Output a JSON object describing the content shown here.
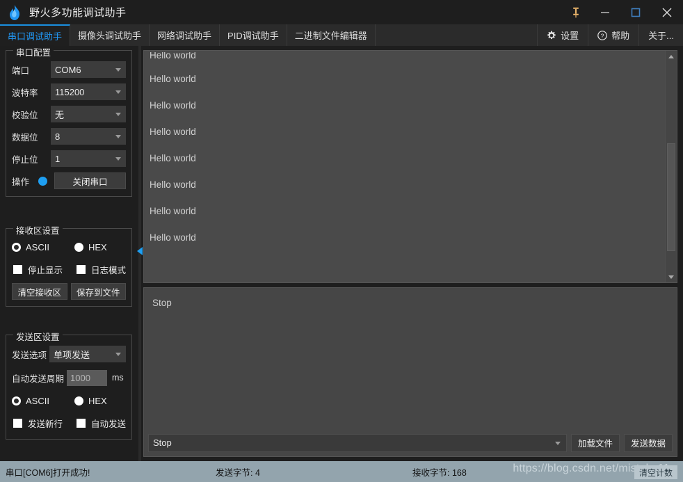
{
  "window": {
    "title": "野火多功能调试助手",
    "logo_icon": "flame-logo-icon",
    "pin_icon": "pin-icon",
    "minimize_icon": "minimize-icon",
    "maximize_icon": "maximize-icon",
    "close_icon": "close-icon"
  },
  "tabs": [
    {
      "label": "串口调试助手",
      "active": true
    },
    {
      "label": "摄像头调试助手",
      "active": false
    },
    {
      "label": "网络调试助手",
      "active": false
    },
    {
      "label": "PID调试助手",
      "active": false
    },
    {
      "label": "二进制文件编辑器",
      "active": false
    }
  ],
  "toolbar": {
    "settings_label": "设置",
    "settings_icon": "gear-icon",
    "help_label": "帮助",
    "help_icon": "question-circle-icon",
    "about_label": "关于..."
  },
  "serial_config": {
    "legend": "串口配置",
    "port_label": "端口",
    "port_value": "COM6",
    "baud_label": "波特率",
    "baud_value": "115200",
    "parity_label": "校验位",
    "parity_value": "无",
    "data_bits_label": "数据位",
    "data_bits_value": "8",
    "stop_bits_label": "停止位",
    "stop_bits_value": "1",
    "operation_label": "操作",
    "operation_button": "关闭串口",
    "led_color": "#1e9ff2"
  },
  "recv_settings": {
    "legend": "接收区设置",
    "ascii_label": "ASCII",
    "hex_label": "HEX",
    "ascii_selected": true,
    "stop_display_label": "停止显示",
    "log_mode_label": "日志模式",
    "clear_button": "清空接收区",
    "save_button": "保存到文件"
  },
  "send_settings": {
    "legend": "发送区设置",
    "send_option_label": "发送选项",
    "send_option_value": "单项发送",
    "auto_period_label": "自动发送周期",
    "auto_period_value": "1000",
    "auto_period_unit": "ms",
    "ascii_label": "ASCII",
    "hex_label": "HEX",
    "ascii_selected": true,
    "newline_label": "发送新行",
    "auto_send_label": "自动发送"
  },
  "receive_area": {
    "lines": [
      "Hello world",
      "Hello world",
      "Hello world",
      "Hello world",
      "Hello world",
      "Hello world",
      "Hello world",
      "Hello world"
    ],
    "scroll_up_icon": "scroll-up-arrow-icon",
    "scroll_down_icon": "scroll-down-arrow-icon"
  },
  "send_area": {
    "text": "Stop",
    "history_value": "Stop",
    "load_file_button": "加载文件",
    "send_data_button": "发送数据"
  },
  "statusbar": {
    "connection": "串口[COM6]打开成功!",
    "tx_bytes": "发送字节: 4",
    "rx_bytes": "接收字节: 168",
    "clear_count_button": "清空计数",
    "watermark": "https://blog.csdn.net/mistake11a"
  },
  "colors": {
    "accent": "#1e9ff2",
    "titlebar_bg": "#1e1e1e",
    "panel_bg": "#4a4a4a",
    "statusbar_bg": "#93a4ad"
  }
}
